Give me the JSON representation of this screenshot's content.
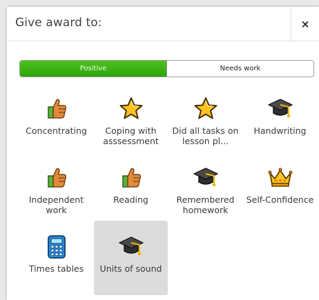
{
  "dialog": {
    "title": "Give award to:",
    "close_label": "×"
  },
  "toggle": {
    "positive_label": "Positive",
    "needs_work_label": "Needs work",
    "active": "positive"
  },
  "colors": {
    "positive_green": "#36ab12",
    "selected_tile": "#dcdcdc"
  },
  "awards": [
    {
      "label": "Concentrating",
      "icon": "thumbs-up-icon"
    },
    {
      "label": "Coping with asssessment",
      "icon": "star-icon"
    },
    {
      "label": "Did all tasks on lesson pl...",
      "icon": "star-icon"
    },
    {
      "label": "Handwriting",
      "icon": "graduation-cap-icon"
    },
    {
      "label": "Independent work",
      "icon": "thumbs-up-icon"
    },
    {
      "label": "Reading",
      "icon": "thumbs-up-icon"
    },
    {
      "label": "Remembered homework",
      "icon": "graduation-cap-icon"
    },
    {
      "label": "Self-Confidence",
      "icon": "crown-icon"
    },
    {
      "label": "Times tables",
      "icon": "calculator-icon"
    },
    {
      "label": "Units of sound",
      "icon": "graduation-cap-icon",
      "selected": true
    }
  ]
}
